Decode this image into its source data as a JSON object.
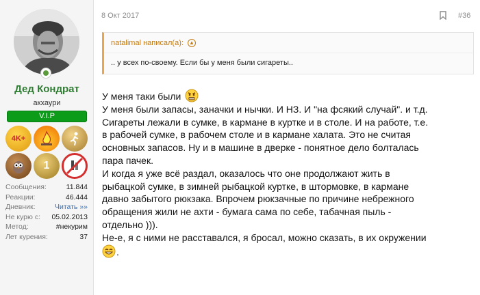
{
  "user": {
    "name": "Дед Кондрат",
    "title": "акхаури",
    "badge": "V.I.P",
    "online": true,
    "avatar_icon": "user-avatar-photo",
    "trophies": [
      {
        "icon": "4k-plus-medal-icon",
        "label": "4K+",
        "color": "#e9a412"
      },
      {
        "icon": "campfire-medal-icon",
        "label": "",
        "color": "#e88a2c"
      },
      {
        "icon": "runner-medal-icon",
        "label": "",
        "color": "#c89a4a"
      },
      {
        "icon": "owl-medal-icon",
        "label": "",
        "color": "#8a5a2b"
      },
      {
        "icon": "number-one-medal-icon",
        "label": "1",
        "color": "#b8912c"
      },
      {
        "icon": "no-smoking-drinking-medal-icon",
        "label": "",
        "color": "#d32f2f"
      }
    ],
    "stats": [
      {
        "label": "Сообщения:",
        "value": "11.844",
        "link": false
      },
      {
        "label": "Реакции:",
        "value": "46.444",
        "link": false
      },
      {
        "label": "Дневник:",
        "value": "Читать »»",
        "link": true
      },
      {
        "label": "Не курю с:",
        "value": "05.02.2013",
        "link": false
      },
      {
        "label": "Метод:",
        "value": "#некурим",
        "link": false
      },
      {
        "label": "Лет курения:",
        "value": "37",
        "link": false
      }
    ]
  },
  "post": {
    "date": "8 Окт 2017",
    "number": "#36",
    "quote": {
      "author_line": "natalimal написал(а):",
      "text": ".. у всех по-своему. Если бы у меня были сигареты.."
    },
    "lines": [
      "У меня таки были",
      "У меня были запасы, заначки и нычки. И НЗ. И \"на фсякий случай\". и т.д.",
      "Сигареты лежали в сумке, в кармане в куртке и в столе. И на работе, т.е.",
      "в рабочей сумке, в рабочем столе и в кармане халата. Это не считая",
      "основных запасов. Ну и в машине в дверке - понятное дело болталась",
      "пара пачек.",
      "И когда я уже всё раздал, оказалось что оне продолжают жить в",
      "рыбацкой сумке, в зимней рыбацкой куртке, в штормовке, в кармане",
      "давно забытого рюкзака. Впрочем рюкзачные по причине небрежного",
      "обращения жили не ахти - бумага сама по себе, табачная пыль -",
      "отдельно ))).",
      "Не-е, я с ними не расставался, я бросал, можно сказать, в их окружении",
      "."
    ],
    "smileys": [
      "grumpy-smiley-icon",
      "grin-smiley-icon"
    ]
  },
  "colors": {
    "username": "#2e7d32",
    "vip": "#0c9c19",
    "quote_accent": "#e8a64e",
    "link": "#3a6fb0"
  }
}
